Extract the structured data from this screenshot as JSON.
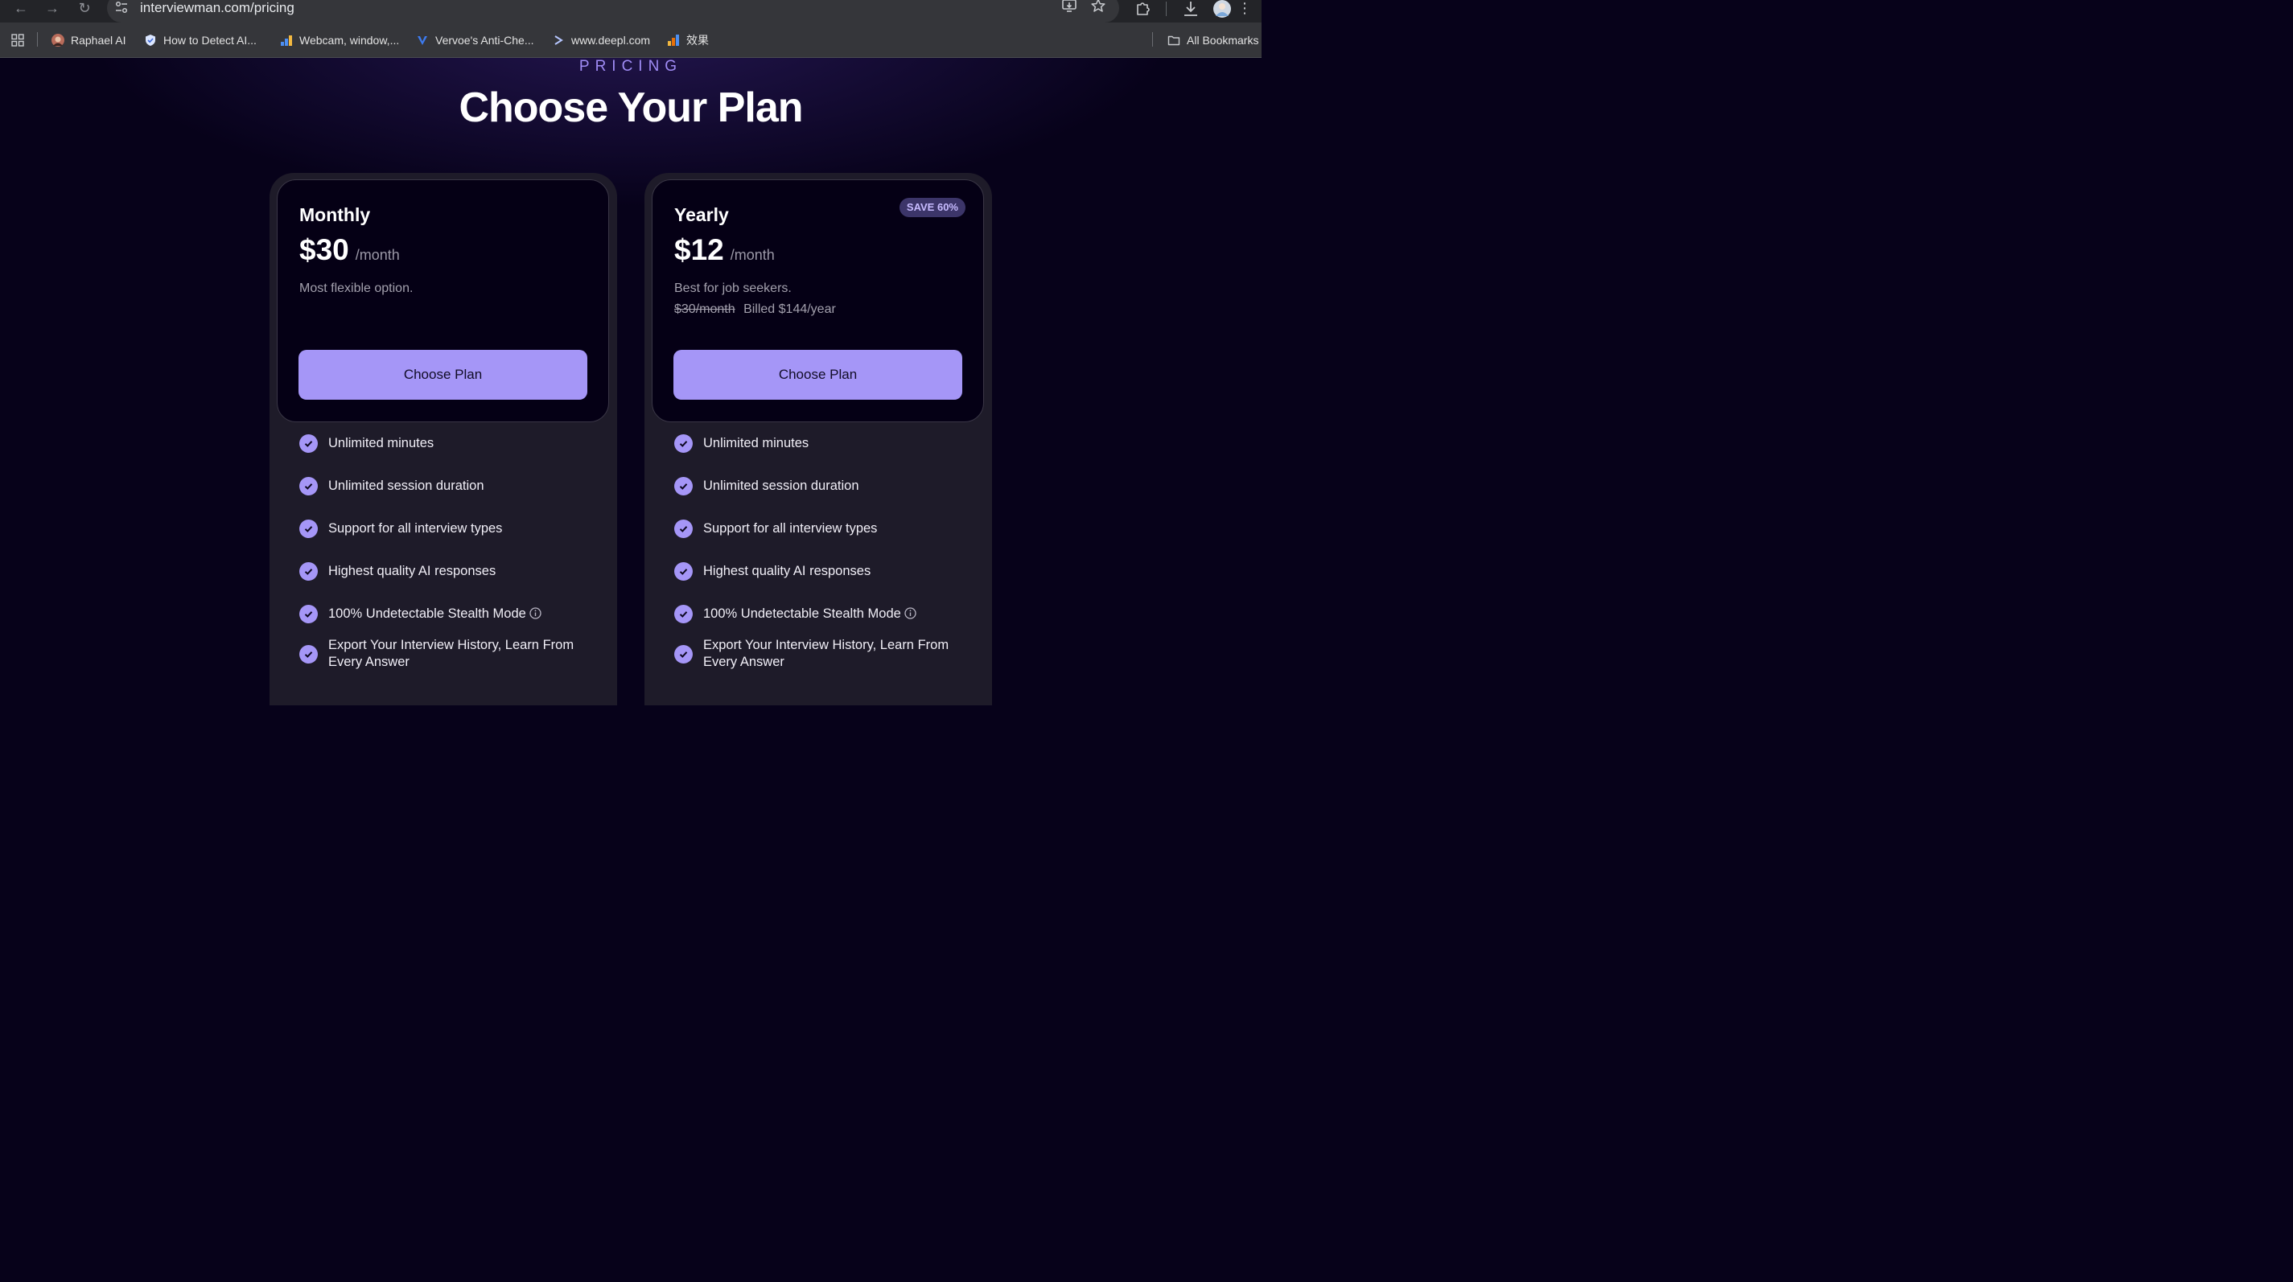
{
  "browser": {
    "url": "interviewman.com/pricing",
    "bookmarks": [
      {
        "label": "Raphael AI",
        "icon": "raphael-avatar-icon"
      },
      {
        "label": "How to Detect AI...",
        "icon": "shield-icon"
      },
      {
        "label": "Webcam, window,...",
        "icon": "bar-chart-icon"
      },
      {
        "label": "Vervoe's Anti-Che...",
        "icon": "vervoe-icon"
      },
      {
        "label": "www.deepl.com",
        "icon": "deepl-icon"
      },
      {
        "label": "效果",
        "icon": "analytics-icon"
      }
    ],
    "all_bookmarks_label": "All Bookmarks"
  },
  "page": {
    "eyebrow": "PRICING",
    "title": "Choose Your Plan",
    "accent_color": "#a596f7"
  },
  "plans": [
    {
      "name": "Monthly",
      "price": "$30",
      "period": "/month",
      "description": "Most flexible option.",
      "cta": "Choose Plan",
      "features": [
        "Unlimited minutes",
        "Unlimited session duration",
        "Support for all interview types",
        "Highest quality AI responses",
        "100% Undetectable Stealth Mode",
        "Export Your Interview History, Learn From Every Answer"
      ]
    },
    {
      "name": "Yearly",
      "badge": "SAVE 60%",
      "price": "$12",
      "period": "/month",
      "description": "Best for job seekers.",
      "original_price": "$30/month",
      "billing": "Billed $144/year",
      "cta": "Choose Plan",
      "features": [
        "Unlimited minutes",
        "Unlimited session duration",
        "Support for all interview types",
        "Highest quality AI responses",
        "100% Undetectable Stealth Mode",
        "Export Your Interview History, Learn From Every Answer"
      ]
    }
  ]
}
